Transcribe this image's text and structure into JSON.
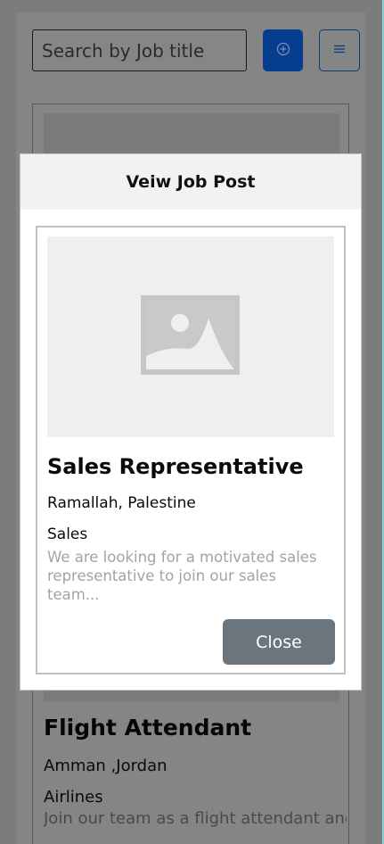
{
  "search": {
    "placeholder": "Search by Job title",
    "value": ""
  },
  "toolbar": {
    "add_icon": "plus-circle-icon",
    "menu_icon": "hamburger-icon"
  },
  "background_card": {
    "title": "Flight Attendant",
    "location": "Amman ,Jordan",
    "category": "Airlines",
    "description": "Join our team as a flight attendant and"
  },
  "modal": {
    "title": "Veiw Job Post",
    "image_icon": "image-placeholder-icon",
    "job": {
      "title": "Sales Representative",
      "location": "Ramallah, Palestine",
      "category": "Sales",
      "description": "We are looking for a motivated sales representative to join our sales team..."
    },
    "close_label": "Close"
  },
  "colors": {
    "primary": "#0d6efd",
    "secondary": "#6c757d",
    "overlay": "#808080"
  }
}
